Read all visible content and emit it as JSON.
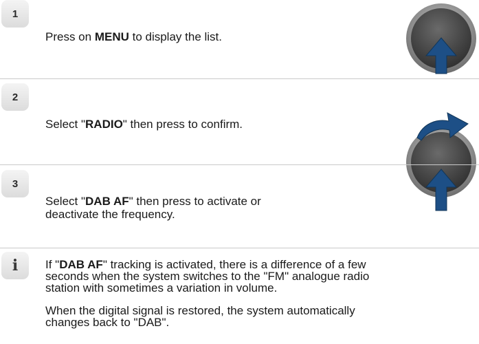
{
  "steps": [
    {
      "number": "1",
      "parts": {
        "pre": "Press on ",
        "bold": "MENU",
        "post": " to display the list."
      }
    },
    {
      "number": "2",
      "parts": {
        "pre": "Select \"",
        "bold": "RADIO",
        "post": "\" then press to confirm."
      }
    },
    {
      "number": "3",
      "parts": {
        "pre": "Select \"",
        "bold": "DAB AF",
        "post": "\" then press to activate or",
        "line2": "deactivate the frequency."
      }
    }
  ],
  "note": {
    "icon": "i",
    "icon_name": "info-icon",
    "para1": {
      "pre": "If \"",
      "bold": "DAB AF",
      "post": "\" tracking is activated, there is a difference of a few",
      "line2": "seconds when the system switches to the \"FM\" analogue radio",
      "line3": "station with sometimes a variation in volume."
    },
    "para2": {
      "line1": "When the digital signal is restored, the system automatically",
      "line2": "changes back to \"DAB\"."
    }
  },
  "icons": {
    "knob_press": "press-knob-icon",
    "knob_rotate_press": "rotate-press-knob-icon"
  },
  "colors": {
    "arrow": "#1d4f86",
    "knob_face": "#444444",
    "knob_rim": "#9a9a9a",
    "divider": "#c9c9c9"
  }
}
